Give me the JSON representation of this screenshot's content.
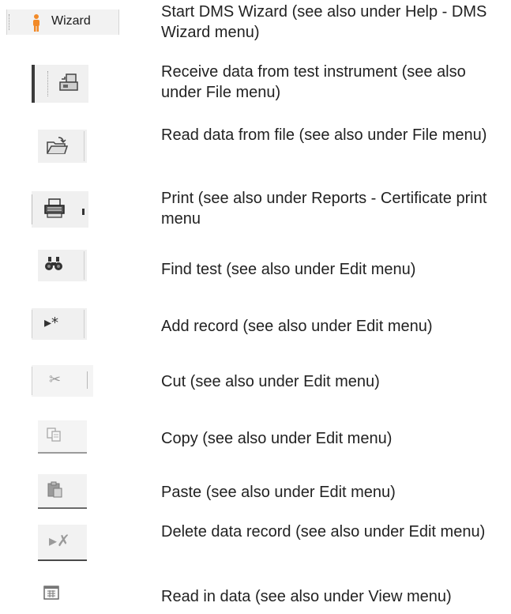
{
  "rows": [
    {
      "icon": "wizard-person-icon",
      "label": "Wizard",
      "text": "Start DMS Wizard (see also under Help - DMS Wizard menu)"
    },
    {
      "icon": "receive-data-icon",
      "text": "Receive data from test instrument (see also under File menu)"
    },
    {
      "icon": "open-folder-icon",
      "text": "Read data from file (see also under File menu)"
    },
    {
      "icon": "printer-icon",
      "text": "Print (see also under Reports - Certificate print menu"
    },
    {
      "icon": "binoculars-icon",
      "text": "Find test (see also under Edit menu)"
    },
    {
      "icon": "add-record-icon",
      "text": "Add record (see also under Edit menu)"
    },
    {
      "icon": "scissors-icon",
      "text": "Cut (see also under Edit menu)"
    },
    {
      "icon": "copy-icon",
      "text": "Copy (see also under Edit menu)"
    },
    {
      "icon": "paste-icon",
      "text": "Paste (see also under Edit menu)"
    },
    {
      "icon": "delete-record-icon",
      "text": "Delete data record (see also under Edit menu)"
    },
    {
      "icon": "calendar-grid-icon",
      "text": "Read in data (see also under View menu)"
    }
  ]
}
